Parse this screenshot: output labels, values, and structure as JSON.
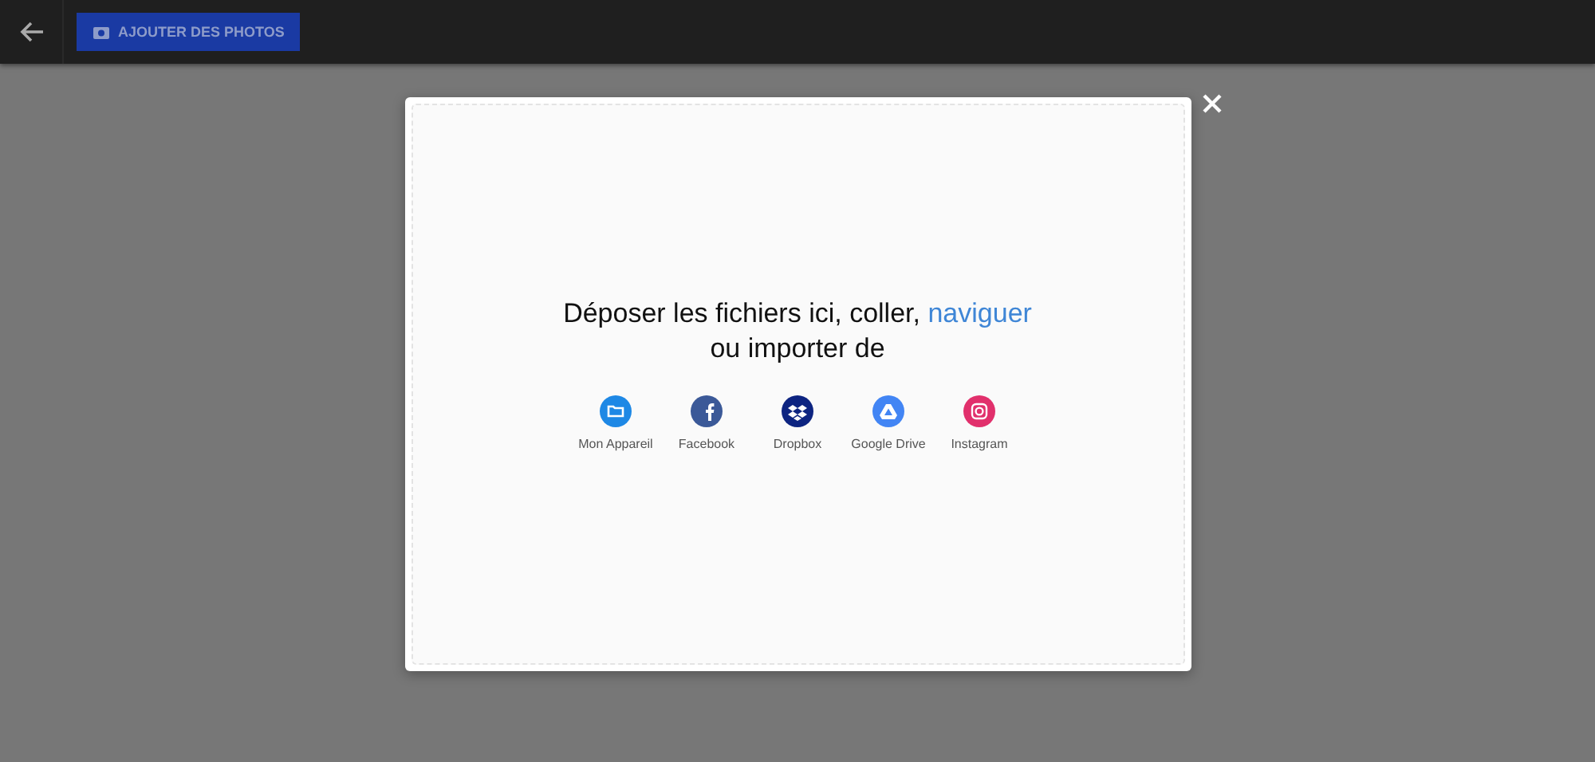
{
  "toolbar": {
    "add_button": "AJOUTER DES PHOTOS"
  },
  "dialog": {
    "prompt": "Déposer les fichiers ici, coller,",
    "browse_link": "naviguer",
    "prompt_line2": "ou importer de",
    "sources": [
      {
        "kind": "device",
        "label": "Mon Appareil",
        "color": "#1e88e5"
      },
      {
        "kind": "facebook",
        "label": "Facebook",
        "color": "#3b5998"
      },
      {
        "kind": "dropbox",
        "label": "Dropbox",
        "color": "#0d2481"
      },
      {
        "kind": "drive",
        "label": "Google Drive",
        "color": "#4285f4"
      },
      {
        "kind": "instagram",
        "label": "Instagram",
        "color": "#e1306c"
      }
    ]
  }
}
